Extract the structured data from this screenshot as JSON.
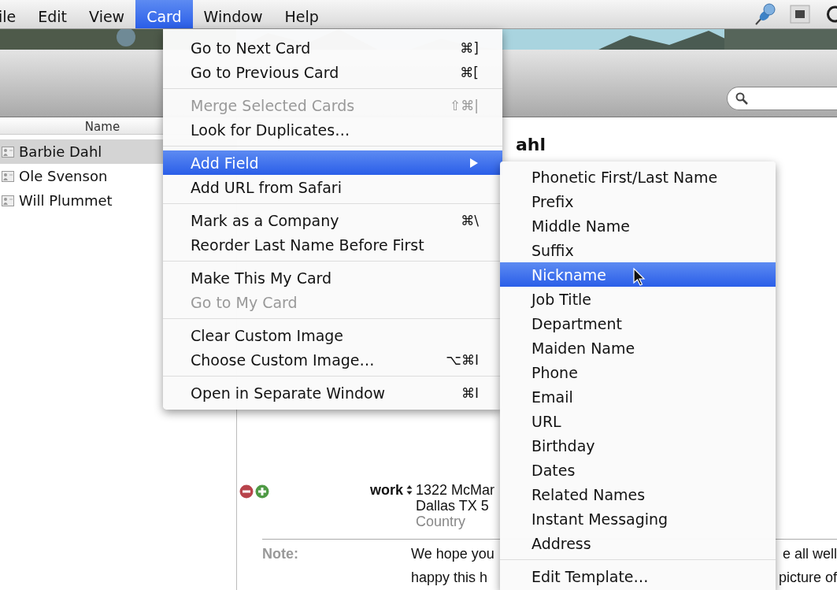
{
  "menubar": {
    "items": [
      {
        "label": "ile",
        "selected": false
      },
      {
        "label": "Edit",
        "selected": false
      },
      {
        "label": "View",
        "selected": false
      },
      {
        "label": "Card",
        "selected": true
      },
      {
        "label": "Window",
        "selected": false
      },
      {
        "label": "Help",
        "selected": false
      }
    ]
  },
  "contacts": {
    "header": "Name",
    "rows": [
      {
        "name": "Barbie Dahl",
        "selected": true
      },
      {
        "name": "Ole Svenson",
        "selected": false
      },
      {
        "name": "Will Plummet",
        "selected": false
      }
    ]
  },
  "card": {
    "name": "ahl",
    "address": {
      "label": "work",
      "lines": [
        {
          "text": "1322 McMar",
          "kind": "value"
        },
        {
          "text": "Dallas TX 5",
          "kind": "value"
        },
        {
          "text": "Country",
          "kind": "placeholder"
        }
      ]
    },
    "note": {
      "label": "Note:",
      "lines": [
        {
          "left": "We hope you",
          "right": "e all well"
        },
        {
          "left": "happy this h",
          "right": "picture of"
        }
      ]
    }
  },
  "card_menu": {
    "sections": [
      [
        {
          "label": "Go to Next Card",
          "shortcut": "⌘]",
          "disabled": false,
          "selected": false,
          "has_submenu": false
        },
        {
          "label": "Go to Previous Card",
          "shortcut": "⌘[",
          "disabled": false,
          "selected": false,
          "has_submenu": false
        }
      ],
      [
        {
          "label": "Merge Selected Cards",
          "shortcut": "⇧⌘|",
          "disabled": true,
          "selected": false,
          "has_submenu": false
        },
        {
          "label": "Look for Duplicates…",
          "disabled": false,
          "selected": false,
          "has_submenu": false
        }
      ],
      [
        {
          "label": "Add Field",
          "disabled": false,
          "selected": true,
          "has_submenu": true
        },
        {
          "label": "Add URL from Safari",
          "disabled": false,
          "selected": false,
          "has_submenu": false
        }
      ],
      [
        {
          "label": "Mark as a Company",
          "shortcut": "⌘\\",
          "disabled": false,
          "selected": false,
          "has_submenu": false
        },
        {
          "label": "Reorder Last Name Before First",
          "disabled": false,
          "selected": false,
          "has_submenu": false
        }
      ],
      [
        {
          "label": "Make This My Card",
          "disabled": false,
          "selected": false,
          "has_submenu": false
        },
        {
          "label": "Go to My Card",
          "disabled": true,
          "selected": false,
          "has_submenu": false
        }
      ],
      [
        {
          "label": "Clear Custom Image",
          "disabled": false,
          "selected": false,
          "has_submenu": false
        },
        {
          "label": "Choose Custom Image…",
          "shortcut": "⌥⌘I",
          "disabled": false,
          "selected": false,
          "has_submenu": false
        }
      ],
      [
        {
          "label": "Open in Separate Window",
          "shortcut": "⌘I",
          "disabled": false,
          "selected": false,
          "has_submenu": false
        }
      ]
    ]
  },
  "submenu": {
    "sections": [
      [
        {
          "label": "Phonetic First/Last Name",
          "selected": false
        },
        {
          "label": "Prefix",
          "selected": false
        },
        {
          "label": "Middle Name",
          "selected": false
        },
        {
          "label": "Suffix",
          "selected": false
        },
        {
          "label": "Nickname",
          "selected": true
        },
        {
          "label": "Job Title",
          "selected": false
        },
        {
          "label": "Department",
          "selected": false
        },
        {
          "label": "Maiden Name",
          "selected": false
        },
        {
          "label": "Phone",
          "selected": false
        },
        {
          "label": "Email",
          "selected": false
        },
        {
          "label": "URL",
          "selected": false
        },
        {
          "label": "Birthday",
          "selected": false
        },
        {
          "label": "Dates",
          "selected": false
        },
        {
          "label": "Related Names",
          "selected": false
        },
        {
          "label": "Instant Messaging",
          "selected": false
        },
        {
          "label": "Address",
          "selected": false
        }
      ],
      [
        {
          "label": "Edit Template…",
          "selected": false
        }
      ]
    ]
  }
}
